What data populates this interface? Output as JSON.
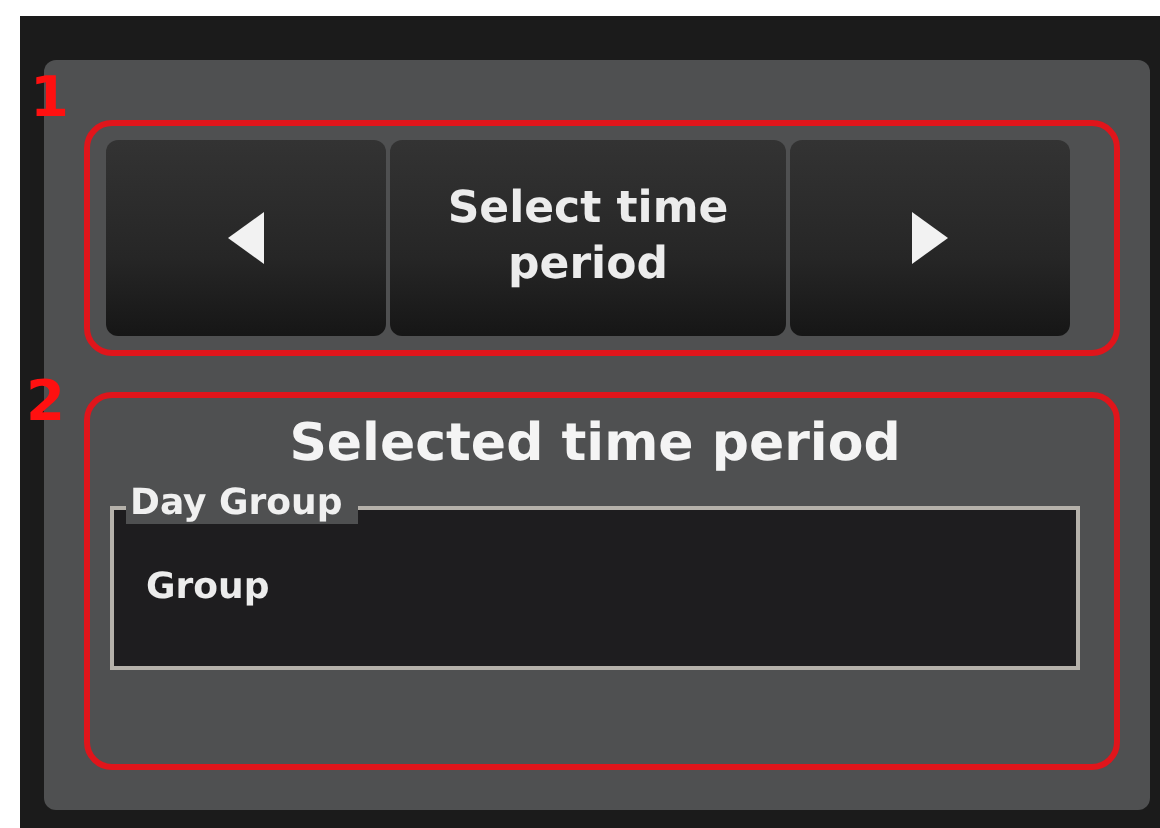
{
  "selector": {
    "marker": "1",
    "button_label": "Select time period"
  },
  "selected_panel": {
    "marker": "2",
    "title": "Selected time period",
    "field_label": "Day Group",
    "field_value": "Group"
  }
}
